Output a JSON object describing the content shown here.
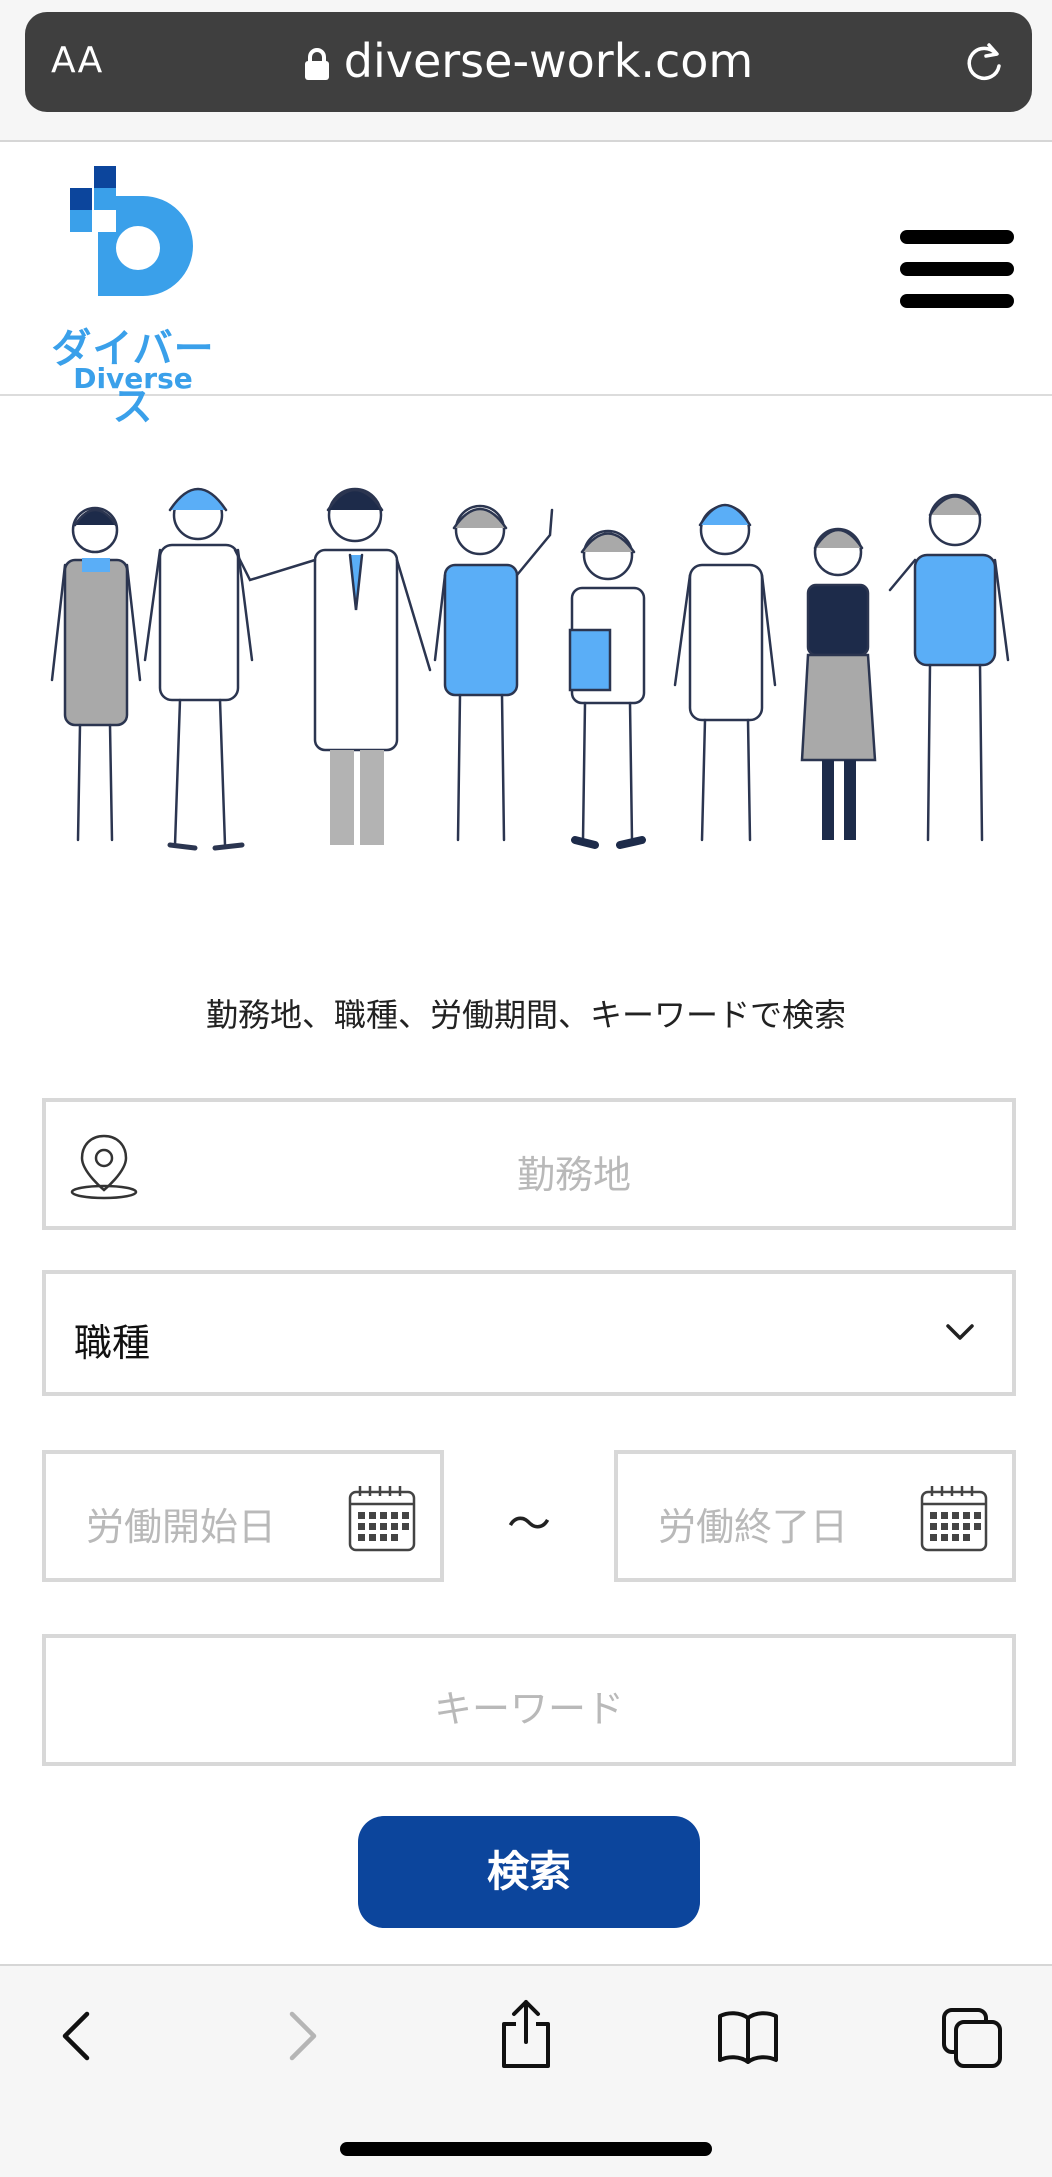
{
  "browser": {
    "text_size_label": "AA",
    "url": "diverse-work.com"
  },
  "site": {
    "logo_kana": "ダイバース",
    "logo_en": "Diverse"
  },
  "search": {
    "caption": "勤務地、職種、労働期間、キーワードで検索",
    "location_placeholder": "勤務地",
    "jobtype_label": "職種",
    "start_placeholder": "労働開始日",
    "range_separator": "〜",
    "end_placeholder": "労働終了日",
    "keyword_placeholder": "キーワード",
    "button_label": "検索"
  },
  "colors": {
    "brand_blue": "#3aa0ea",
    "button_navy": "#0c459c",
    "illustration_accent": "#5aaef7"
  },
  "icons": [
    "lock-icon",
    "reload-icon",
    "hamburger-menu-icon",
    "location-pin-icon",
    "chevron-down-icon",
    "calendar-icon",
    "back-icon",
    "forward-icon",
    "share-icon",
    "bookmarks-icon",
    "tabs-icon"
  ]
}
